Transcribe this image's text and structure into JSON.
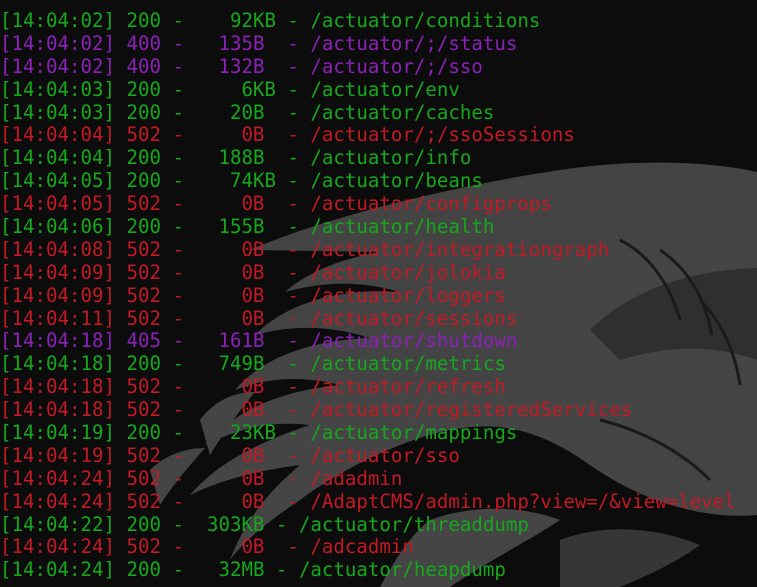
{
  "palette": {
    "background": "#0c0c0c",
    "ok": "#16a81c",
    "client_error": "#8b21b8",
    "server_error": "#c21a24",
    "wallpaper_art": "#4a4a4a"
  },
  "log": [
    {
      "time": "[14:04:02]",
      "status": "200",
      "size": "92KB",
      "path": "/actuator/conditions",
      "kind": "ok"
    },
    {
      "time": "[14:04:02]",
      "status": "400",
      "size": "135B",
      "path": "/actuator/;/status",
      "kind": "cerr"
    },
    {
      "time": "[14:04:02]",
      "status": "400",
      "size": "132B",
      "path": "/actuator/;/sso",
      "kind": "cerr"
    },
    {
      "time": "[14:04:03]",
      "status": "200",
      "size": "6KB",
      "path": "/actuator/env",
      "kind": "ok"
    },
    {
      "time": "[14:04:03]",
      "status": "200",
      "size": "20B",
      "path": "/actuator/caches",
      "kind": "ok"
    },
    {
      "time": "[14:04:04]",
      "status": "502",
      "size": "0B",
      "path": "/actuator/;/ssoSessions",
      "kind": "serr"
    },
    {
      "time": "[14:04:04]",
      "status": "200",
      "size": "188B",
      "path": "/actuator/info",
      "kind": "ok"
    },
    {
      "time": "[14:04:05]",
      "status": "200",
      "size": "74KB",
      "path": "/actuator/beans",
      "kind": "ok"
    },
    {
      "time": "[14:04:05]",
      "status": "502",
      "size": "0B",
      "path": "/actuator/configprops",
      "kind": "serr"
    },
    {
      "time": "[14:04:06]",
      "status": "200",
      "size": "155B",
      "path": "/actuator/health",
      "kind": "ok"
    },
    {
      "time": "[14:04:08]",
      "status": "502",
      "size": "0B",
      "path": "/actuator/integrationgraph",
      "kind": "serr"
    },
    {
      "time": "[14:04:09]",
      "status": "502",
      "size": "0B",
      "path": "/actuator/jolokia",
      "kind": "serr"
    },
    {
      "time": "[14:04:09]",
      "status": "502",
      "size": "0B",
      "path": "/actuator/loggers",
      "kind": "serr"
    },
    {
      "time": "[14:04:11]",
      "status": "502",
      "size": "0B",
      "path": "/actuator/sessions",
      "kind": "serr"
    },
    {
      "time": "[14:04:18]",
      "status": "405",
      "size": "161B",
      "path": "/actuator/shutdown",
      "kind": "cerr"
    },
    {
      "time": "[14:04:18]",
      "status": "200",
      "size": "749B",
      "path": "/actuator/metrics",
      "kind": "ok"
    },
    {
      "time": "[14:04:18]",
      "status": "502",
      "size": "0B",
      "path": "/actuator/refresh",
      "kind": "serr"
    },
    {
      "time": "[14:04:18]",
      "status": "502",
      "size": "0B",
      "path": "/actuator/registeredServices",
      "kind": "serr"
    },
    {
      "time": "[14:04:19]",
      "status": "200",
      "size": "23KB",
      "path": "/actuator/mappings",
      "kind": "ok"
    },
    {
      "time": "[14:04:19]",
      "status": "502",
      "size": "0B",
      "path": "/actuator/sso",
      "kind": "serr"
    },
    {
      "time": "[14:04:24]",
      "status": "502",
      "size": "0B",
      "path": "/adadmin",
      "kind": "serr"
    },
    {
      "time": "[14:04:24]",
      "status": "502",
      "size": "0B",
      "path": "/AdaptCMS/admin.php?view=/&view=level",
      "kind": "serr"
    },
    {
      "time": "[14:04:22]",
      "status": "200",
      "size": "303KB",
      "path": "/actuator/threaddump",
      "kind": "ok"
    },
    {
      "time": "[14:04:24]",
      "status": "502",
      "size": "0B",
      "path": "/adcadmin",
      "kind": "serr"
    },
    {
      "time": "[14:04:24]",
      "status": "200",
      "size": "32MB",
      "path": "/actuator/heapdump",
      "kind": "ok"
    }
  ]
}
